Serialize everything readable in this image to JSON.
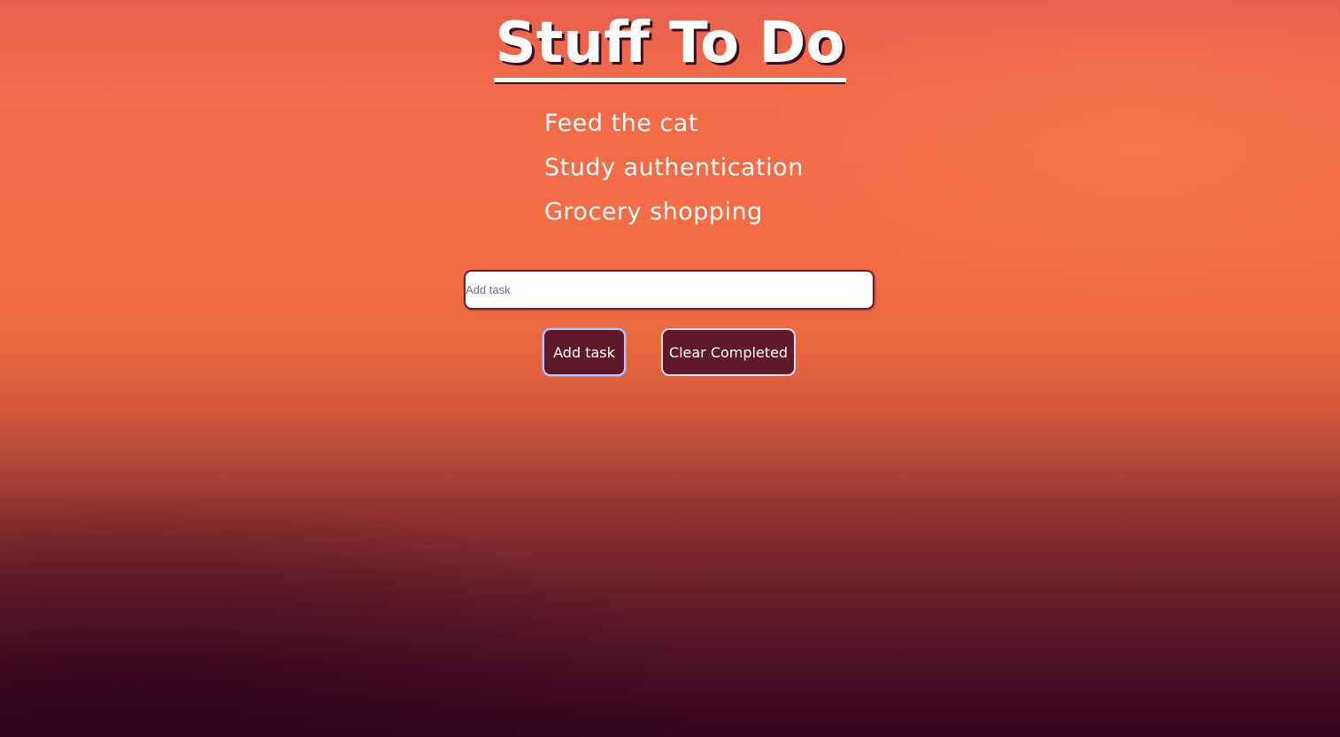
{
  "header": {
    "title": "Stuff To Do"
  },
  "tasks": [
    {
      "label": "Feed the cat"
    },
    {
      "label": "Study authentication"
    },
    {
      "label": "Grocery shopping"
    }
  ],
  "new_task": {
    "value": "",
    "placeholder": "Add task"
  },
  "actions": {
    "add_label": "Add task",
    "clear_label": "Clear Completed"
  }
}
